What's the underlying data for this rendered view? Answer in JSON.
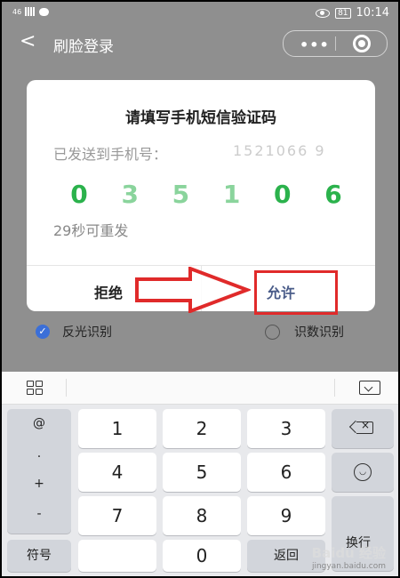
{
  "status_bar": {
    "carrier": "46",
    "time": "10:14",
    "battery": "81"
  },
  "header": {
    "back": "<",
    "title": "刷脸登录",
    "more": "•••"
  },
  "options": {
    "left_label": "反光识别",
    "right_label": "识数识别"
  },
  "dialog": {
    "title": "请填写手机短信验证码",
    "sent_label": "已发送到手机号：",
    "phone_masked": "1521066 9",
    "code_digits": [
      "0",
      "3",
      "5",
      "1",
      "0",
      "6"
    ],
    "resend_text": "29秒可重发",
    "deny_label": "拒绝",
    "allow_label": "允许"
  },
  "keyboard": {
    "symbol_column": [
      "@",
      ".",
      "+",
      "-"
    ],
    "keys": [
      "1",
      "2",
      "3",
      "4",
      "5",
      "6",
      "7",
      "8",
      "9",
      "0"
    ],
    "symbols_label": "符号",
    "return_label": "返回",
    "newline_label": "换行"
  },
  "watermark": {
    "brand": "Baidu 经验",
    "url": "jingyan.baidu.com"
  },
  "colors": {
    "code_green": "#2bb24c",
    "allow_blue": "#4a5c89",
    "highlight_red": "#e02a2a",
    "checkbox_blue": "#3b6fd8"
  }
}
